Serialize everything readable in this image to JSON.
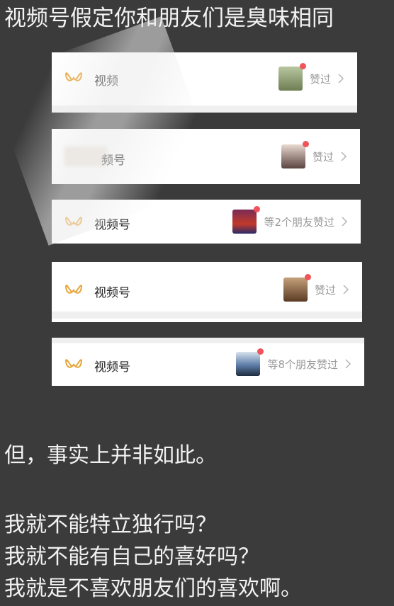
{
  "title": "视频号假定你和朋友们是臭味相同",
  "cards": [
    {
      "label": "视频",
      "like": "赞过"
    },
    {
      "label": "频号",
      "like": "赞过"
    },
    {
      "label": "视频号",
      "like": "等2个朋友赞过"
    },
    {
      "label": "视频号",
      "like": "赞过"
    },
    {
      "label": "视频号",
      "like": "等8个朋友赞过"
    }
  ],
  "body": {
    "line1": "但，事实上并非如此。",
    "line2": "我就不能特立独行吗？",
    "line3": "我就不能有自己的喜好吗？",
    "line4": "我就是不喜欢朋友们的喜欢啊。"
  },
  "colors": {
    "background": "#3b3b3b",
    "logo": "#e8a53a",
    "dot": "#f0545a",
    "muted_text": "#9a9a9a"
  }
}
